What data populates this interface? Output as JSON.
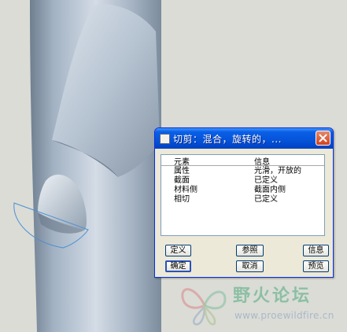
{
  "dialog": {
    "title": "切剪：混合，旋转的，...",
    "header": {
      "element": "元素",
      "info": "信息"
    },
    "rows": [
      {
        "element": "属性",
        "info": "光滑，开放的"
      },
      {
        "element": "截面",
        "info": "已定义"
      },
      {
        "element": "材料侧",
        "info": "截面内侧"
      },
      {
        "element": "相切",
        "info": "已定义"
      }
    ],
    "buttons": {
      "define": "定义",
      "refs": "参照",
      "info": "信息",
      "ok": "确定",
      "cancel": "取消",
      "preview": "预览"
    }
  },
  "watermark": {
    "text": "野火论坛",
    "url": "www.proewildfire.cn"
  },
  "colors": {
    "titlebar": "#0553d9",
    "close": "#d2421b",
    "dialog_bg": "#ece9d8",
    "model_body": "#a8b6c6",
    "viewport_bg": "#dbdcd6"
  }
}
